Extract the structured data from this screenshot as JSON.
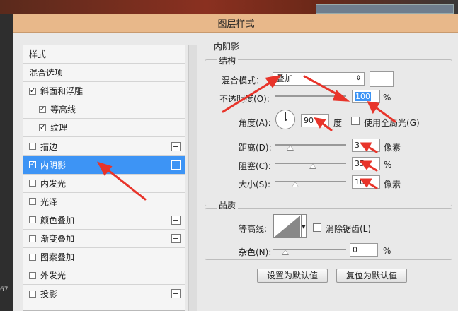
{
  "background": {
    "zoom_text": "67"
  },
  "dialog": {
    "title": "图层样式",
    "list": [
      {
        "label": "样式",
        "checkbox": false,
        "plus": false,
        "indent": false,
        "selected": false,
        "checked": false
      },
      {
        "label": "混合选项",
        "checkbox": false,
        "plus": false,
        "indent": false,
        "selected": false,
        "checked": false
      },
      {
        "label": "斜面和浮雕",
        "checkbox": true,
        "plus": false,
        "indent": false,
        "selected": false,
        "checked": true
      },
      {
        "label": "等高线",
        "checkbox": true,
        "plus": false,
        "indent": true,
        "selected": false,
        "checked": true
      },
      {
        "label": "纹理",
        "checkbox": true,
        "plus": false,
        "indent": true,
        "selected": false,
        "checked": true
      },
      {
        "label": "描边",
        "checkbox": true,
        "plus": true,
        "indent": false,
        "selected": false,
        "checked": false
      },
      {
        "label": "内阴影",
        "checkbox": true,
        "plus": true,
        "indent": false,
        "selected": true,
        "checked": true
      },
      {
        "label": "内发光",
        "checkbox": true,
        "plus": false,
        "indent": false,
        "selected": false,
        "checked": false
      },
      {
        "label": "光泽",
        "checkbox": true,
        "plus": false,
        "indent": false,
        "selected": false,
        "checked": false
      },
      {
        "label": "颜色叠加",
        "checkbox": true,
        "plus": true,
        "indent": false,
        "selected": false,
        "checked": false
      },
      {
        "label": "渐变叠加",
        "checkbox": true,
        "plus": true,
        "indent": false,
        "selected": false,
        "checked": false
      },
      {
        "label": "图案叠加",
        "checkbox": true,
        "plus": false,
        "indent": false,
        "selected": false,
        "checked": false
      },
      {
        "label": "外发光",
        "checkbox": true,
        "plus": false,
        "indent": false,
        "selected": false,
        "checked": false
      },
      {
        "label": "投影",
        "checkbox": true,
        "plus": true,
        "indent": false,
        "selected": false,
        "checked": false
      }
    ],
    "panel": {
      "title": "内阴影",
      "structure": {
        "label": "结构",
        "blend_mode_label": "混合模式：",
        "blend_mode_value": "叠加",
        "opacity_label": "不透明度(O):",
        "opacity_value": "100",
        "opacity_level": 100,
        "percent": "%",
        "angle_label": "角度(A):",
        "angle_value": "90",
        "degree": "度",
        "global_light_label": "使用全局光(G)",
        "distance_label": "距离(D):",
        "distance_value": "3",
        "distance_unit": "像素",
        "distance_level": 3,
        "choke_label": "阻塞(C):",
        "choke_value": "35",
        "choke_level": 35,
        "size_label": "大小(S):",
        "size_value": "10",
        "size_unit": "像素",
        "size_level": 10
      },
      "quality": {
        "label": "品质",
        "contour_label": "等高线:",
        "antialias_label": "消除锯齿(L)",
        "noise_label": "杂色(N):",
        "noise_value": "0",
        "noise_level": 0
      },
      "buttons": {
        "set_default": "设置为默认值",
        "reset_default": "复位为默认值"
      }
    }
  },
  "colors": {
    "selected": "#3d94f5",
    "title_bar": "#e8b88a",
    "arrow": "#e8342a"
  },
  "icons": {
    "checkbox": "check-mark",
    "plus": "plus-icon",
    "dial": "angle-dial-icon",
    "dropdown": "up-down-arrow-icon"
  }
}
